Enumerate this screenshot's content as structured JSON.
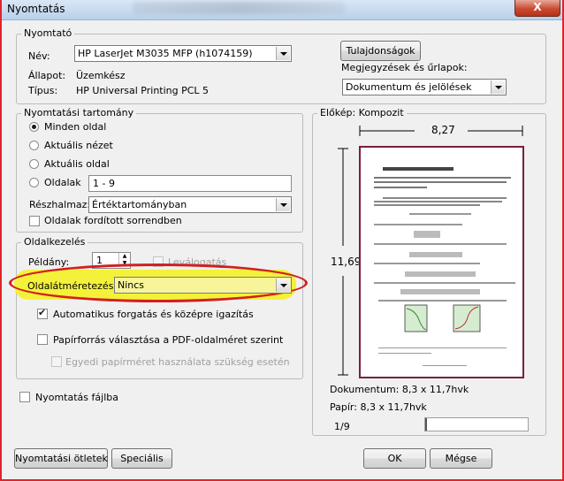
{
  "window": {
    "title": "Nyomtatás",
    "close_label": "X"
  },
  "printer": {
    "group_label": "Nyomtató",
    "name_label": "Név:",
    "name_value": "HP LaserJet M3035 MFP (h1074159)",
    "status_label": "Állapot:",
    "status_value": "Üzemkész",
    "type_label": "Típus:",
    "type_value": "HP Universal Printing PCL 5",
    "properties_button": "Tulajdonságok",
    "comments_label": "Megjegyzések és űrlapok:",
    "comments_value": "Dokumentum és jelölések"
  },
  "range": {
    "group_label": "Nyomtatási tartomány",
    "options": [
      "Minden oldal",
      "Aktuális nézet",
      "Aktuális oldal",
      "Oldalak"
    ],
    "selected": "Minden oldal",
    "pages_value": "1 - 9",
    "subset_label": "Részhalmaz:",
    "subset_value": "Értéktartományban",
    "reverse_label": "Oldalak fordított sorrendben"
  },
  "handling": {
    "group_label": "Oldalkezelés",
    "copies_label": "Példány:",
    "copies_value": "1",
    "collate_label": "Leválogatás",
    "scaling_label": "Oldalátméretezés:",
    "scaling_value": "Nincs",
    "auto_rotate_label": "Automatikus forgatás és középre igazítás",
    "auto_rotate_checked": true,
    "paper_source_label": "Papírforrás választása a PDF-oldalméret szerint",
    "custom_paper_label": "Egyedi papírméret használata szükség esetén"
  },
  "print_to_file_label": "Nyomtatás fájlba",
  "preview": {
    "group_label": "Előkép: Kompozit",
    "width_value": "8,27",
    "height_value": "11,69",
    "document_label": "Dokumentum: 8,3 x 11,7hvk",
    "paper_label": "Papír: 8,3 x 11,7hvk",
    "page_indicator": "1/9"
  },
  "buttons": {
    "tips": "Nyomtatási ötletek",
    "special": "Speciális",
    "ok": "OK",
    "cancel": "Mégse"
  },
  "colors": {
    "highlight": "#f4f13a",
    "annotation": "#d21f1f"
  }
}
